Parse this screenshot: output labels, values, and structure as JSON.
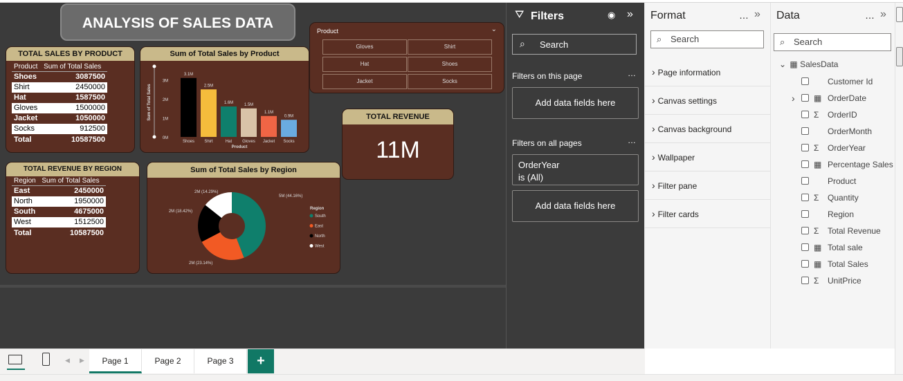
{
  "report_title": "ANALYSIS OF SALES DATA",
  "sales_table": {
    "title": "TOTAL SALES BY PRODUCT",
    "headers": [
      "Product",
      "Sum of Total Sales"
    ],
    "rows": [
      [
        "Shoes",
        "3087500"
      ],
      [
        "Shirt",
        "2450000"
      ],
      [
        "Hat",
        "1587500"
      ],
      [
        "Gloves",
        "1500000"
      ],
      [
        "Jacket",
        "1050000"
      ],
      [
        "Socks",
        "912500"
      ]
    ],
    "total": [
      "Total",
      "10587500"
    ]
  },
  "region_table": {
    "title": "TOTAL REVENUE BY REGION",
    "headers": [
      "Region",
      "Sum of Total Sales"
    ],
    "rows": [
      [
        "East",
        "2450000"
      ],
      [
        "North",
        "1950000"
      ],
      [
        "South",
        "4675000"
      ],
      [
        "West",
        "1512500"
      ]
    ],
    "total": [
      "Total",
      "10587500"
    ]
  },
  "chart_data": [
    {
      "type": "bar",
      "title": "Sum of Total Sales by Product",
      "xlabel": "Product",
      "ylabel": "Sum of Total Sales",
      "categories": [
        "Shoes",
        "Shirt",
        "Hat",
        "Gloves",
        "Jacket",
        "Socks"
      ],
      "values": [
        3.1,
        2.5,
        1.6,
        1.5,
        1.1,
        0.9
      ],
      "data_labels": [
        "3.1M",
        "2.5M",
        "1.6M",
        "1.5M",
        "1.1M",
        "0.9M"
      ],
      "colors": [
        "#000000",
        "#f5bc3c",
        "#0f7f6c",
        "#d9c3a8",
        "#f06545",
        "#6aabe0"
      ],
      "yticks": [
        "0M",
        "1M",
        "2M",
        "3M"
      ],
      "ylim": [
        0,
        3.2
      ]
    },
    {
      "type": "pie",
      "title": "Sum of Total Sales by Region",
      "legend_title": "Region",
      "categories": [
        "South",
        "East",
        "North",
        "West"
      ],
      "values": [
        4675000,
        2450000,
        1950000,
        1512500
      ],
      "data_labels": [
        "5M (44.16%)",
        "2M (23.14%)",
        "2M (18.42%)",
        "2M (14.29%)"
      ],
      "colors": [
        "#0f7f6c",
        "#f25a24",
        "#000000",
        "#ffffff"
      ]
    }
  ],
  "slicer": {
    "title": "Product",
    "items": [
      "Gloves",
      "Shirt",
      "Hat",
      "Shoes",
      "Jacket",
      "Socks"
    ]
  },
  "revenue_card": {
    "title": "TOTAL REVENUE",
    "value": "11M"
  },
  "filters_pane": {
    "title": "Filters",
    "search_placeholder": "Search",
    "on_page": "Filters on this page",
    "add_fields": "Add data fields here",
    "all_pages": "Filters on all pages",
    "filter_field": "OrderYear",
    "filter_value": "is (All)",
    "add_fields_2": "Add data fields here"
  },
  "format_pane": {
    "title": "Format",
    "search_placeholder": "Search",
    "items": [
      "Page information",
      "Canvas settings",
      "Canvas background",
      "Wallpaper",
      "Filter pane",
      "Filter cards"
    ]
  },
  "data_pane": {
    "title": "Data",
    "search_placeholder": "Search",
    "table_name": "SalesData",
    "fields": [
      {
        "name": "Customer Id",
        "glyph": ""
      },
      {
        "name": "OrderDate",
        "glyph": "▦",
        "expand": true
      },
      {
        "name": "OrderID",
        "glyph": "Σ"
      },
      {
        "name": "OrderMonth",
        "glyph": ""
      },
      {
        "name": "OrderYear",
        "glyph": "Σ"
      },
      {
        "name": "Percentage Sales",
        "glyph": "▦"
      },
      {
        "name": "Product",
        "glyph": ""
      },
      {
        "name": "Quantity",
        "glyph": "Σ"
      },
      {
        "name": "Region",
        "glyph": ""
      },
      {
        "name": "Total Revenue",
        "glyph": "Σ"
      },
      {
        "name": "Total sale",
        "glyph": "▦"
      },
      {
        "name": "Total Sales",
        "glyph": "▦"
      },
      {
        "name": "UnitPrice",
        "glyph": "Σ"
      }
    ]
  },
  "pages": [
    "Page 1",
    "Page 2",
    "Page 3"
  ],
  "add_page": "+"
}
